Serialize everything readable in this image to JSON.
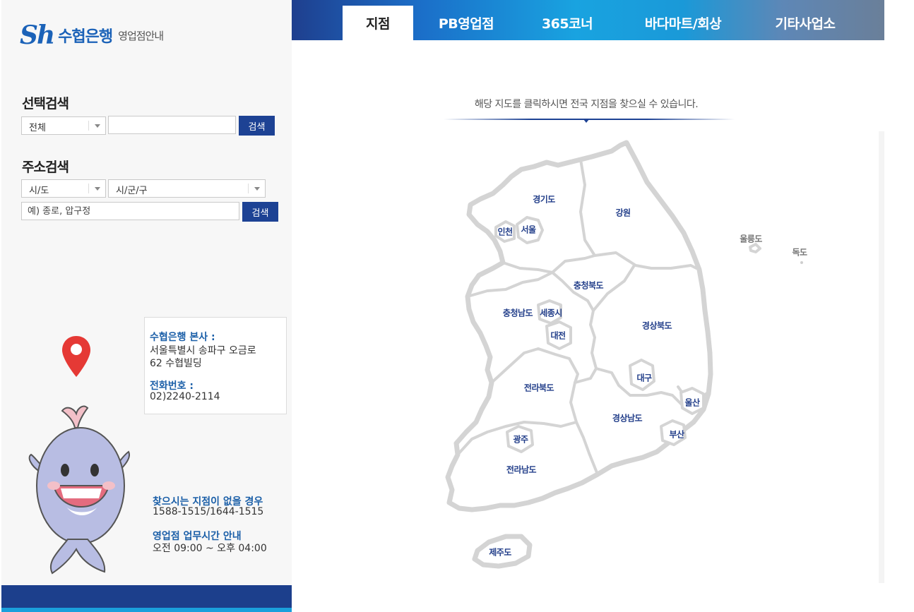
{
  "logo": {
    "mark": "Sh",
    "name": "수협은행",
    "subtitle": "영업점안내"
  },
  "select_search": {
    "title": "선택검색",
    "category_value": "전체",
    "search_input_value": "",
    "search_button": "검색"
  },
  "address_search": {
    "title": "주소검색",
    "city_value": "시/도",
    "district_value": "시/군/구",
    "address_placeholder": "예) 종로, 압구정",
    "search_button": "검색"
  },
  "headquarters": {
    "label": "수협은행 본사 :",
    "address_line1": "서울특별시 송파구 오금로",
    "address_line2": "62 수협빌딩",
    "phone_label": "전화번호 :",
    "phone": "02)2240-2114"
  },
  "contact": {
    "not_found_label": "찾으시는 지점이 없을 경우",
    "not_found_phones": "1588-1515/1644-1515",
    "hours_label": "영업점 업무시간 안내",
    "hours": "오전 09:00 ~ 오후 04:00"
  },
  "tabs": [
    {
      "label": "지점",
      "active": true
    },
    {
      "label": "PB영업점",
      "active": false
    },
    {
      "label": "365코너",
      "active": false
    },
    {
      "label": "바다마트/회상",
      "active": false
    },
    {
      "label": "기타사업소",
      "active": false
    }
  ],
  "map": {
    "caption": "해당 지도를 클릭하시면 전국 지점을 찾으실 수 있습니다.",
    "regions": {
      "gyeonggi": "경기도",
      "gangwon": "강원",
      "incheon": "인천",
      "seoul": "서울",
      "chungbuk": "충청북도",
      "chungnam": "충청남도",
      "sejong": "세종시",
      "daejeon": "대전",
      "gyeongbuk": "경상북도",
      "daegu": "대구",
      "jeonbuk": "전라북도",
      "ulsan": "울산",
      "gyeongnam": "경상남도",
      "busan": "부산",
      "gwangju": "광주",
      "jeonnam": "전라남도",
      "jeju": "제주도",
      "ulleungdo": "울릉도",
      "dokdo": "독도"
    }
  },
  "colors": {
    "brand_blue": "#1b62b8",
    "button_navy": "#1d4294",
    "label_blue": "#1b5fa8",
    "region_label": "#233f8a",
    "pin_red": "#e53935",
    "mascot_body": "#b8bde3"
  }
}
